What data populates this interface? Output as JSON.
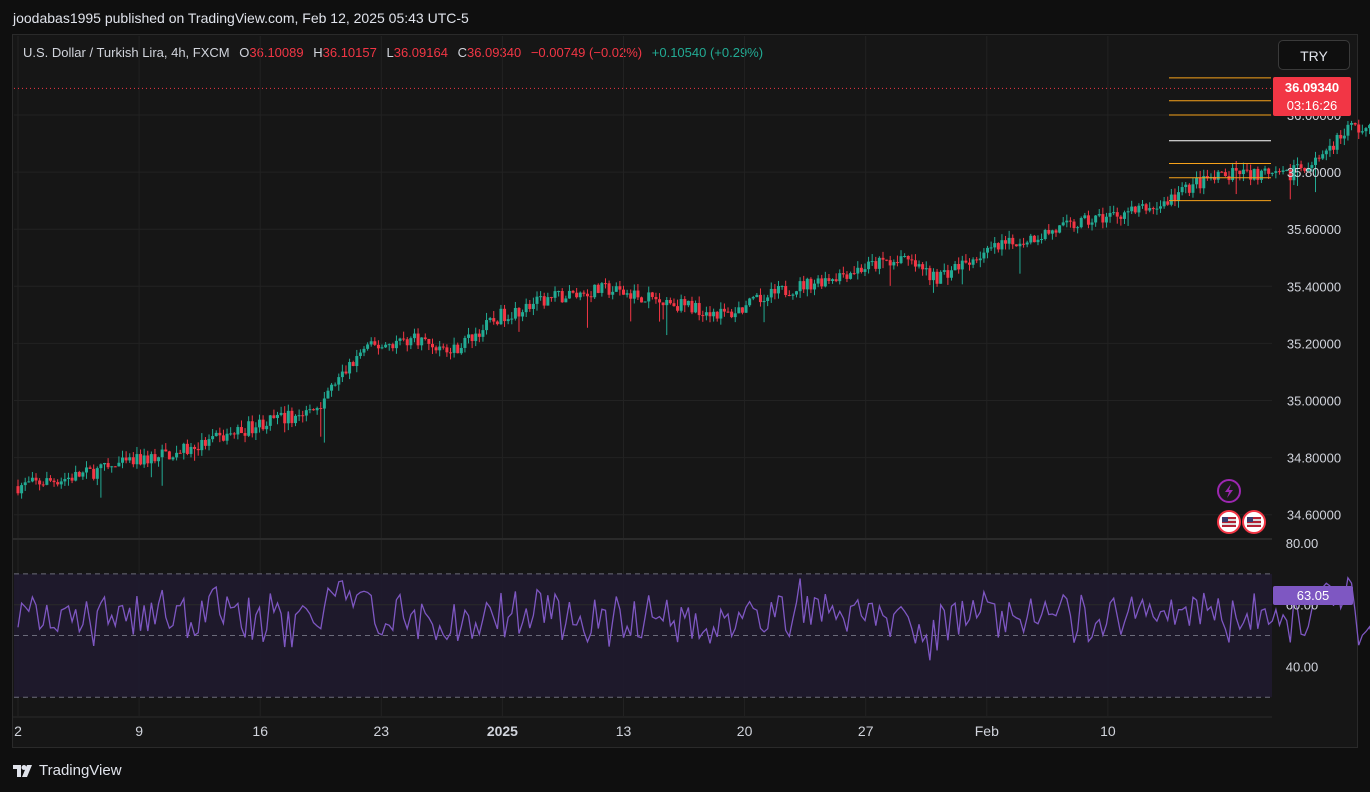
{
  "publisher": "joodabas1995 published on TradingView.com, Feb 12, 2025 05:43 UTC-5",
  "legend": {
    "symbol": "U.S. Dollar / Turkish Lira, 4h, FXCM",
    "open_label": "O",
    "open": "36.10089",
    "high_label": "H",
    "high": "36.10157",
    "low_label": "L",
    "low": "36.09164",
    "close_label": "C",
    "close": "36.09340",
    "change": "−0.00749 (−0.02%)",
    "change2": "+0.10540 (+0.29%)"
  },
  "currency_button": "TRY",
  "price_tag": {
    "price": "36.09340",
    "countdown": "03:16:26"
  },
  "rsi_tag": "63.05",
  "watermark": "TradingView",
  "colors": {
    "up": "#22ab94",
    "down": "#f23645",
    "rsi": "#7e57c2",
    "level": "#f7a21b"
  },
  "chart_data": [
    {
      "type": "candlestick",
      "title": "U.S. Dollar / Turkish Lira, 4h, FXCM",
      "y_ticks": [
        "36.00000",
        "35.80000",
        "35.60000",
        "35.40000",
        "35.20000",
        "35.00000",
        "34.80000",
        "34.60000"
      ],
      "x_ticks": [
        "2",
        "9",
        "16",
        "23",
        "2025",
        "13",
        "20",
        "27",
        "Feb",
        "10"
      ],
      "ylim": [
        34.54,
        36.18
      ],
      "path_close": [
        [
          2,
          34.7
        ],
        [
          5,
          34.73
        ],
        [
          9,
          34.79
        ],
        [
          12,
          34.83
        ],
        [
          16,
          34.92
        ],
        [
          19,
          34.96
        ],
        [
          22,
          35.18
        ],
        [
          25,
          35.22
        ],
        [
          27,
          35.17
        ],
        [
          30,
          35.3
        ],
        [
          33,
          35.36
        ],
        [
          36,
          35.39
        ],
        [
          40,
          35.34
        ],
        [
          43,
          35.3
        ],
        [
          46,
          35.38
        ],
        [
          50,
          35.45
        ],
        [
          53,
          35.5
        ],
        [
          55,
          35.43
        ],
        [
          58,
          35.52
        ],
        [
          61,
          35.58
        ],
        [
          64,
          35.63
        ],
        [
          66,
          35.66
        ],
        [
          68,
          35.68
        ],
        [
          70,
          35.76
        ],
        [
          73,
          35.8
        ],
        [
          75,
          35.78
        ],
        [
          77,
          35.84
        ],
        [
          79,
          35.96
        ],
        [
          81,
          35.93
        ],
        [
          84,
          35.88
        ],
        [
          86,
          35.98
        ],
        [
          88,
          35.96
        ],
        [
          90,
          35.99
        ],
        [
          92,
          36.03
        ],
        [
          93.4,
          36.09
        ]
      ],
      "horizontal_levels": [
        36.13,
        36.05,
        36.0,
        35.91,
        35.83,
        35.78,
        35.7
      ],
      "last_price": 36.0934
    },
    {
      "type": "line",
      "title": "RSI",
      "y_ticks": [
        "80.00",
        "60.00",
        "40.00"
      ],
      "bands": [
        70,
        50,
        30
      ],
      "ylim": [
        30,
        80
      ],
      "last_value": 63.05
    }
  ]
}
